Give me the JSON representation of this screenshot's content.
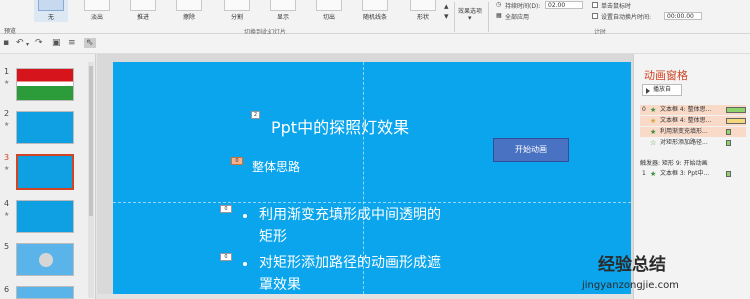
{
  "ribbon": {
    "preview_label": "预览",
    "transitions": [
      "无",
      "淡出",
      "推进",
      "擦除",
      "分割",
      "显示",
      "切出",
      "随机线条",
      "形状"
    ],
    "effect_options_label": "效果选项",
    "group_transitions_label": "切换到此幻灯片",
    "group_timing_label": "计时",
    "duration_label": "持续时间(D):",
    "duration_value": "02.00",
    "apply_all_label": "全部应用",
    "on_click_label": "单击鼠标时",
    "after_label": "设置自动换片时间:",
    "after_value": "00:00.00"
  },
  "slides": [
    {
      "num": "1",
      "star": "★"
    },
    {
      "num": "2",
      "star": "★"
    },
    {
      "num": "3",
      "star": "★"
    },
    {
      "num": "4",
      "star": "★"
    },
    {
      "num": "5",
      "star": ""
    },
    {
      "num": "6",
      "star": ""
    }
  ],
  "slide": {
    "title": "Ppt中的探照灯效果",
    "subtitle": "整体思路",
    "bullet1_line1": "利用渐变充填形成中间透明的",
    "bullet1_line2": "矩形",
    "bullet2_line1": "对矩形添加路径的动画形成遮",
    "bullet2_line2": "罩效果",
    "start_button": "开始动画",
    "tag_title": "2",
    "tag_sub": "0",
    "tag_b1": "0",
    "tag_b2": "0"
  },
  "animation_pane": {
    "title": "动画窗格",
    "play_label": "播放自",
    "rows": [
      {
        "num": "0",
        "text": "文本框 4: 整体思...",
        "color": "#8fd16a"
      },
      {
        "num": "",
        "text": "文本框 4: 整体思...",
        "color": "#f2d87a"
      },
      {
        "num": "",
        "text": "利用渐变充填形...",
        "color": "#8fd16a"
      },
      {
        "num": "",
        "text": "对矩形添加路径...",
        "color": "#8fd16a"
      }
    ],
    "trigger_label": "触发器: 矩形 9: 开始动画",
    "trigger_row": {
      "num": "1",
      "text": "文本框 3: Ppt中...",
      "color": "#8fd16a"
    }
  },
  "watermark": {
    "cn": "经验总结",
    "url": "jingyanzongjie.com"
  }
}
